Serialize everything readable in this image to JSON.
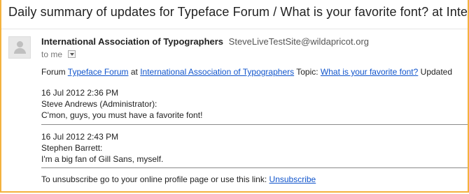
{
  "email": {
    "subject": "Daily summary of updates for Typeface Forum / What is your favorite font? at International Association of Typographers",
    "sender_name": "International Association of Typographers",
    "sender_email": "SteveLiveTestSite@wildapricot.org",
    "recipient": "to me",
    "forum_prefix": "Forum ",
    "forum_name": "Typeface Forum",
    "at_text": " at ",
    "org_name": "International Association of Typographers",
    "topic_prefix": " Topic: ",
    "topic_name": "What is your favorite font?",
    "topic_suffix": " Updated"
  },
  "posts": [
    {
      "timestamp": "16 Jul 2012 2:36 PM",
      "author": "Steve Andrews (Administrator):",
      "message": "C'mon, guys, you must have a favorite font!"
    },
    {
      "timestamp": "16 Jul 2012 2:43 PM",
      "author": "Stephen Barrett:",
      "message": "I'm a big fan of Gill Sans, myself."
    }
  ],
  "footer": {
    "text": "To unsubscribe go to your online profile page or use this link: ",
    "link": "Unsubscribe"
  },
  "icons": {
    "avatar": "person-silhouette-icon",
    "recipient_menu": "chevron-down-icon"
  },
  "colors": {
    "frame_border": "#f4b23e",
    "link": "#1155cc"
  }
}
